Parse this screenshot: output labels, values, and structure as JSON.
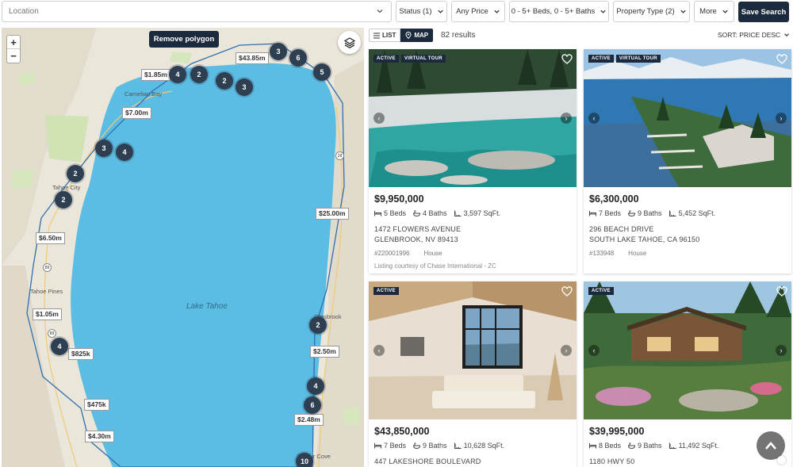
{
  "filters": {
    "location_placeholder": "Location",
    "status": "Status (1)",
    "price": "Any Price",
    "beds_baths": "0 - 5+ Beds, 0 - 5+ Baths",
    "property_type": "Property Type (2)",
    "more": "More",
    "save_search": "Save Search"
  },
  "map": {
    "zoom_in": "+",
    "zoom_out": "−",
    "remove_polygon": "Remove polygon",
    "lake_label": "Lake Tahoe",
    "place_labels": [
      "Carnelian Bay",
      "Tahoe City",
      "Tahoe Pines",
      "Glenbrook",
      "Zephyr Cove"
    ],
    "highway_shields": [
      "28",
      "89",
      "89"
    ],
    "price_pills": [
      "$43.85m",
      "$1.85m",
      "$7.00m",
      "$25.00m",
      "$6.50m",
      "$1.05m",
      "$825k",
      "$2.50m",
      "$475k",
      "$2.48m",
      "$4.30m"
    ],
    "clusters": [
      "3",
      "6",
      "5",
      "4",
      "2",
      "2",
      "3",
      "3",
      "4",
      "2",
      "2",
      "2",
      "4",
      "4",
      "6",
      "10"
    ]
  },
  "results": {
    "list_label": "LIST",
    "map_label": "MAP",
    "count": "82 results",
    "sort": "SORT: PRICE DESC"
  },
  "listings": [
    {
      "badges": [
        "ACTIVE",
        "VIRTUAL TOUR"
      ],
      "price": "$9,950,000",
      "beds": "5 Beds",
      "baths": "4 Baths",
      "sqft": "3,597 SqFt.",
      "address1": "1472 FLOWERS AVENUE",
      "address2": "GLENBROOK, NV 89413",
      "mls": "#220001996",
      "type": "House",
      "courtesy": "Listing courtesy of Chase International - ZC"
    },
    {
      "badges": [
        "ACTIVE",
        "VIRTUAL TOUR"
      ],
      "price": "$6,300,000",
      "beds": "7 Beds",
      "baths": "9 Baths",
      "sqft": "5,452 SqFt.",
      "address1": "296 BEACH DRIVE",
      "address2": "SOUTH LAKE TAHOE, CA 96150",
      "mls": "#133948",
      "type": "House"
    },
    {
      "badges": [
        "ACTIVE"
      ],
      "price": "$43,850,000",
      "beds": "7 Beds",
      "baths": "9 Baths",
      "sqft": "10,628 SqFt.",
      "address1": "447 LAKESHORE BOULEVARD"
    },
    {
      "badges": [
        "ACTIVE"
      ],
      "price": "$39,995,000",
      "beds": "8 Beds",
      "baths": "9 Baths",
      "sqft": "11,492 SqFt.",
      "address1": "1180 HWY 50"
    }
  ],
  "colors": {
    "brand_navy": "#1b2b3d",
    "lake": "#5bbde3",
    "cluster": "#2e3f52"
  }
}
